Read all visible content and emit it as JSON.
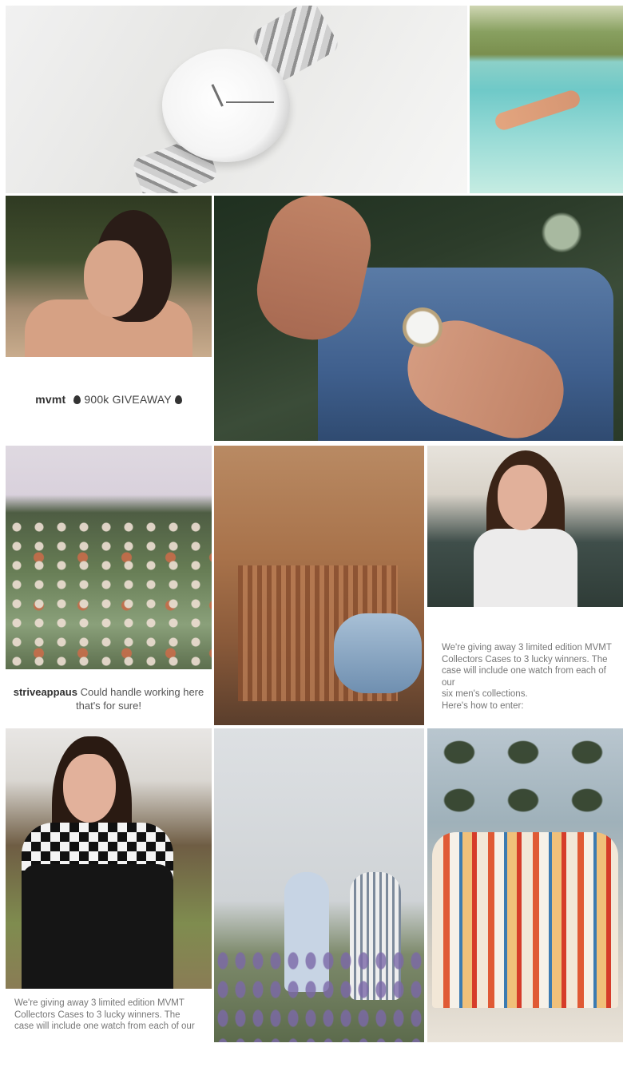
{
  "giveaway": {
    "user": "mvmt",
    "title": "900k GIVEAWAY"
  },
  "comment": {
    "user": "striveappaus",
    "text": "Could handle working here that's for sure!"
  },
  "description": {
    "line1": "We're giving away 3 limited edition MVMT",
    "line2": "Collectors Cases to 3 lucky winners. The",
    "line3": "case will include one watch from each of our",
    "line4": "six men's collections.",
    "line5": "Here's how to enter:"
  },
  "photos": [
    "watch-photo",
    "underwater-photo",
    "woman-portrait-photo",
    "jeans-watch-photo",
    "flowers-photo",
    "fringe-photo",
    "smiling-woman-photo",
    "checkered-jacket-photo",
    "two-girls-photo",
    "surfboards-photo"
  ]
}
